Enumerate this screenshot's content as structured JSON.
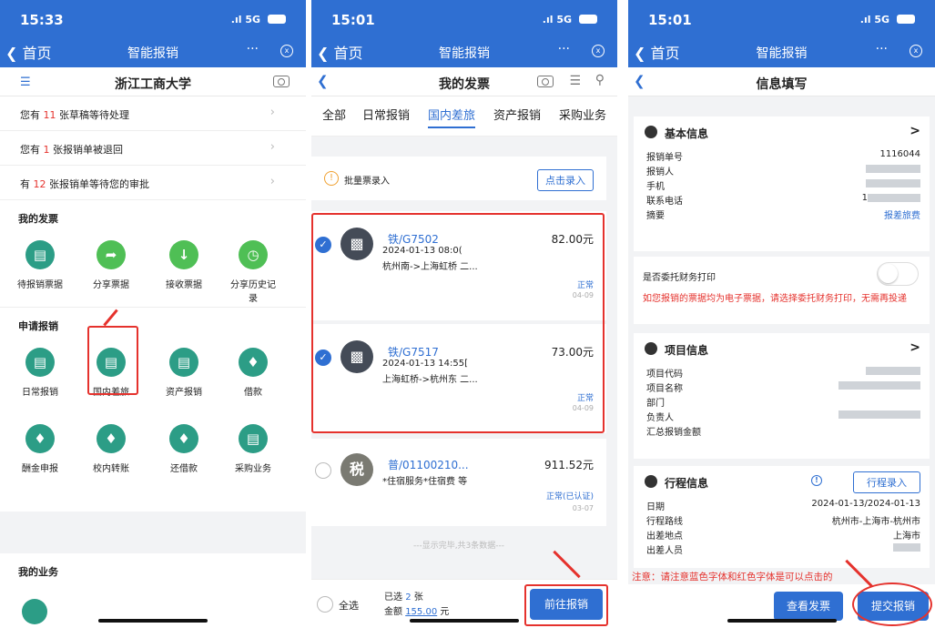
{
  "p1": {
    "time": "15:33",
    "signal": ".ıl 5G",
    "nav": {
      "back": "首页",
      "title": "智能报销",
      "more": "···",
      "close": "x"
    },
    "school": "浙江工商大学",
    "notices": [
      {
        "pre": "您有 ",
        "num": "11",
        "post": " 张草稿等待处理"
      },
      {
        "pre": "您有 ",
        "num": "1",
        "post": " 张报销单被退回"
      },
      {
        "pre": "有 ",
        "num": "12",
        "post": " 张报销单等待您的审批"
      }
    ],
    "invoice_section": "我的发票",
    "invoice_items": [
      "待报销票据",
      "分享票据",
      "接收票据",
      "分享历史记",
      "录"
    ],
    "apply_section": "申请报销",
    "apply_items": [
      "日常报销",
      "国内差旅",
      "资产报销",
      "借款",
      "酬金申报",
      "校内转账",
      "还借款",
      "采购业务"
    ],
    "biz_section": "我的业务"
  },
  "p2": {
    "time": "15:01",
    "signal": ".ıl 5G",
    "nav": {
      "back": "首页",
      "title": "智能报销",
      "more": "···",
      "close": "x"
    },
    "title": "我的发票",
    "tabs": [
      "全部",
      "日常报销",
      "国内差旅",
      "资产报销",
      "采购业务"
    ],
    "batch_label": "批量票录入",
    "batch_btn": "点击录入",
    "tickets": [
      {
        "code": "铁/G7502",
        "time": "2024-01-13 08:0(",
        "route": "杭州南->上海虹桥 二...",
        "amount": "82.00元",
        "status": "正常",
        "date": "04-09",
        "icon": "bus"
      },
      {
        "code": "铁/G7517",
        "time": "2024-01-13 14:55[",
        "route": "上海虹桥->杭州东 二...",
        "amount": "73.00元",
        "status": "正常",
        "date": "04-09",
        "icon": "bus"
      },
      {
        "code": "普/01100210...",
        "time": "",
        "route": "*住宿服务*住宿费 等",
        "amount": "911.52元",
        "status": "正常(已认证)",
        "date": "03-07",
        "icon": "税"
      }
    ],
    "footer_note": "---显示完毕,共3条数据---",
    "select_all": "全选",
    "selected_pre": "已选 ",
    "selected_num": "2",
    "selected_post": " 张",
    "amount_pre": "金额 ",
    "amount_num": "155.00",
    "amount_post": " 元",
    "go_btn": "前往报销"
  },
  "p3": {
    "time": "15:01",
    "signal": ".ıl 5G",
    "nav": {
      "back": "首页",
      "title": "智能报销",
      "more": "···",
      "close": "x"
    },
    "title": "信息填写",
    "basic_head": "基本信息",
    "basic_rows": [
      {
        "k": "报销单号",
        "v": "1116044"
      },
      {
        "k": "报销人",
        "v": ""
      },
      {
        "k": "手机",
        "v": ""
      },
      {
        "k": "联系电话",
        "v": "1"
      },
      {
        "k": "摘要",
        "v": "报差旅费"
      }
    ],
    "entrust_label": "是否委托财务打印",
    "entrust_warn": "如您报销的票据均为电子票据，请选择委托财务打印，无需再投递",
    "project_head": "项目信息",
    "project_rows": [
      "项目代码",
      "项目名称",
      "部门",
      "负责人",
      "汇总报销金额"
    ],
    "trip_head": "行程信息",
    "trip_btn": "行程录入",
    "trip_rows": [
      {
        "k": "日期",
        "v": "2024-01-13/2024-01-13"
      },
      {
        "k": "行程路线",
        "v": "杭州市-上海市-杭州市"
      },
      {
        "k": "出差地点",
        "v": "上海市"
      },
      {
        "k": "出差人员",
        "v": ""
      }
    ],
    "notice": "注意：请注意蓝色字体和红色字体是可以点击的",
    "view_btn": "查看发票",
    "submit_btn": "提交报销"
  }
}
